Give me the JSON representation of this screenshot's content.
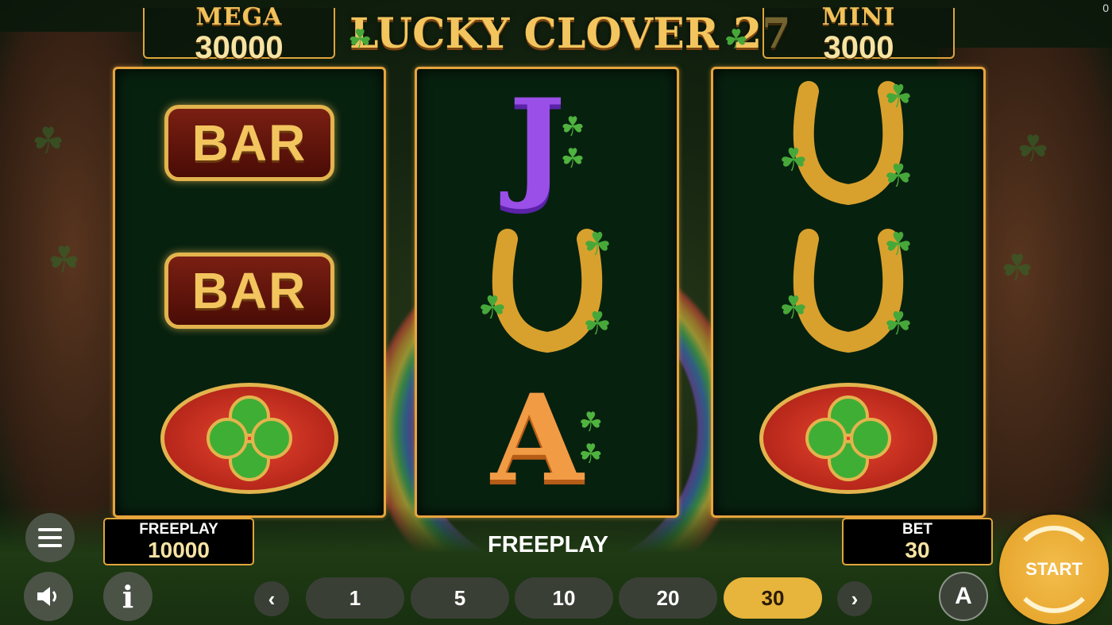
{
  "jackpots": {
    "mega": {
      "label": "MEGA",
      "value": "30000"
    },
    "mini": {
      "label": "MINI",
      "value": "3000"
    }
  },
  "logo": {
    "title": "LUCKY CLOVER 27"
  },
  "reels": [
    [
      "BAR",
      "BAR",
      "clover-oval"
    ],
    [
      "J",
      "horseshoe",
      "A"
    ],
    [
      "horseshoe",
      "horseshoe",
      "clover-oval"
    ]
  ],
  "freeplay_panel": {
    "label": "FREEPLAY",
    "value": "10000"
  },
  "status_text": "FREEPLAY",
  "bet_panel": {
    "label": "BET",
    "value": "30"
  },
  "bet_options": [
    "1",
    "5",
    "10",
    "20",
    "30"
  ],
  "selected_bet": "30",
  "start_label": "START",
  "autoplay_label": "A",
  "info_label": "i",
  "corner_counter": "0",
  "colors": {
    "accent_gold": "#e7b43c",
    "reel_bg": "#07210f",
    "frame_gold": "#e0a53b"
  }
}
